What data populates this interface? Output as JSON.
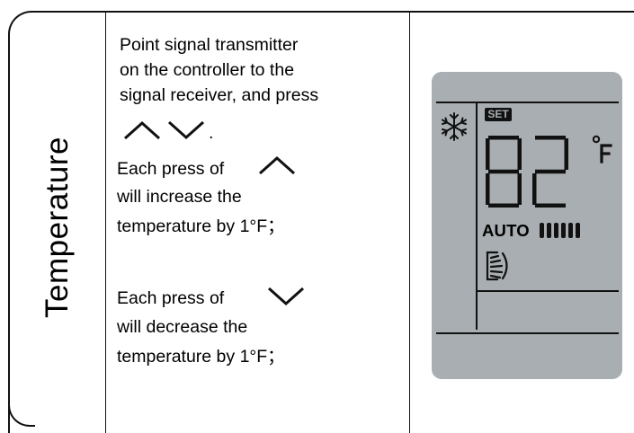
{
  "row": {
    "title": "Temperature"
  },
  "instructions": {
    "line1": "Point signal transmitter",
    "line2": "on the controller to the",
    "line3": "signal receiver, and press",
    "line4_suffix": ".",
    "increase_prefix": "Each press of",
    "increase_line2": "will increase the",
    "increase_line3": "temperature by 1°F；",
    "decrease_prefix": "Each press of",
    "decrease_line2": "will decrease the",
    "decrease_line3": "temperature by 1°F；"
  },
  "display": {
    "mode_icon": "snowflake-icon",
    "set_label": "SET",
    "temperature": "82",
    "unit": "°F",
    "fan_mode": "AUTO",
    "fan_speed_bars": 6,
    "swing_icon": "louver-swing-icon",
    "colors": {
      "panel": "#a8aeb1",
      "segments": "#111111"
    }
  }
}
